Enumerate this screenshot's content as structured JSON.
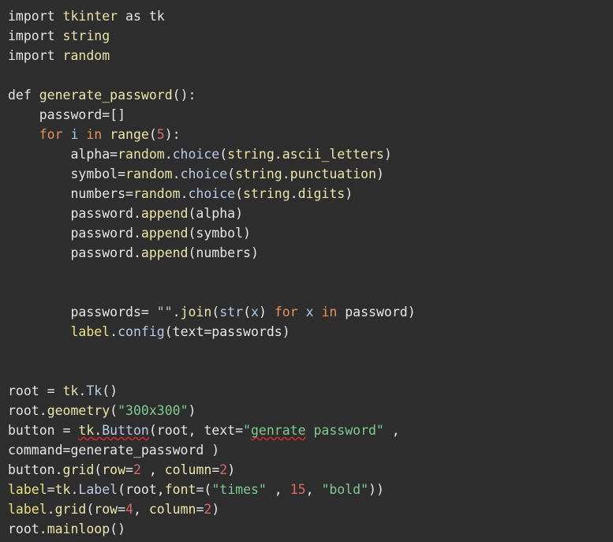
{
  "editor": {
    "background_color": "#2e2e2e",
    "default_text_color": "#e6e6e6",
    "language": "python",
    "palette": {
      "keyword": "#e8915a",
      "function": "#ece7a8",
      "method": "#b8cbe8",
      "identifier": "#a8c8e8",
      "number": "#d96a6a",
      "string": "#7fcc8f",
      "module": "#e9e3a4",
      "label_variable": "#e9e27e",
      "spellcheck_underline": "#cc2b2b"
    }
  },
  "code": {
    "lines": [
      {
        "id": "l1",
        "text": "import tkinter as tk"
      },
      {
        "id": "l2",
        "text": "import string"
      },
      {
        "id": "l3",
        "text": "import random"
      },
      {
        "id": "l4",
        "text": ""
      },
      {
        "id": "l5",
        "text": "def generate_password():"
      },
      {
        "id": "l6",
        "text": "    password=[]"
      },
      {
        "id": "l7",
        "text": "    for i in range(5):"
      },
      {
        "id": "l8",
        "text": "        alpha=random.choice(string.ascii_letters)"
      },
      {
        "id": "l9",
        "text": "        symbol=random.choice(string.punctuation)"
      },
      {
        "id": "l10",
        "text": "        numbers=random.choice(string.digits)"
      },
      {
        "id": "l11",
        "text": "        password.append(alpha)"
      },
      {
        "id": "l12",
        "text": "        password.append(symbol)"
      },
      {
        "id": "l13",
        "text": "        password.append(numbers)"
      },
      {
        "id": "l14",
        "text": ""
      },
      {
        "id": "l15",
        "text": ""
      },
      {
        "id": "l16",
        "text": "        passwords= \"\".join(str(x) for x in password)"
      },
      {
        "id": "l17",
        "text": "        label.config(text=passwords)"
      },
      {
        "id": "l18",
        "text": ""
      },
      {
        "id": "l19",
        "text": ""
      },
      {
        "id": "l20",
        "text": "root = tk.Tk()"
      },
      {
        "id": "l21",
        "text": "root.geometry(\"300x300\")"
      },
      {
        "id": "l22",
        "text": "button = tk.Button(root, text=\"genrate password\" ,"
      },
      {
        "id": "l23",
        "text": "command=generate_password )"
      },
      {
        "id": "l24",
        "text": "button.grid(row=2 , column=2)"
      },
      {
        "id": "l25",
        "text": "label=tk.Label(root,font=(\"times\" , 15, \"bold\"))"
      },
      {
        "id": "l26",
        "text": "label.grid(row=4, column=2)"
      },
      {
        "id": "l27",
        "text": "root.mainloop()"
      }
    ],
    "tokens": {
      "l1": [
        {
          "t": "import",
          "c": "c-plain"
        },
        {
          "t": " ",
          "c": "c-plain"
        },
        {
          "t": "tkinter",
          "c": "c-mod"
        },
        {
          "t": " ",
          "c": "c-plain"
        },
        {
          "t": "as",
          "c": "c-plain"
        },
        {
          "t": " ",
          "c": "c-plain"
        },
        {
          "t": "tk",
          "c": "c-plain"
        }
      ],
      "l2": [
        {
          "t": "import",
          "c": "c-plain"
        },
        {
          "t": " ",
          "c": "c-plain"
        },
        {
          "t": "string",
          "c": "c-mod"
        }
      ],
      "l3": [
        {
          "t": "import",
          "c": "c-plain"
        },
        {
          "t": " ",
          "c": "c-plain"
        },
        {
          "t": "random",
          "c": "c-mod"
        }
      ],
      "l5": [
        {
          "t": "def",
          "c": "c-plain"
        },
        {
          "t": " ",
          "c": "c-plain"
        },
        {
          "t": "generate_password",
          "c": "c-fn"
        },
        {
          "t": "():",
          "c": "c-plain"
        }
      ],
      "l6": [
        {
          "t": "    password=[]",
          "c": "c-plain"
        }
      ],
      "l7": [
        {
          "t": "    ",
          "c": "c-plain"
        },
        {
          "t": "for",
          "c": "c-kw"
        },
        {
          "t": " ",
          "c": "c-plain"
        },
        {
          "t": "i",
          "c": "c-ident"
        },
        {
          "t": " ",
          "c": "c-plain"
        },
        {
          "t": "in",
          "c": "c-kw"
        },
        {
          "t": " ",
          "c": "c-plain"
        },
        {
          "t": "range",
          "c": "c-fn"
        },
        {
          "t": "(",
          "c": "c-plain"
        },
        {
          "t": "5",
          "c": "c-num"
        },
        {
          "t": "):",
          "c": "c-plain"
        }
      ],
      "l8": [
        {
          "t": "        alpha=",
          "c": "c-plain"
        },
        {
          "t": "random",
          "c": "c-mod"
        },
        {
          "t": ".",
          "c": "c-plain"
        },
        {
          "t": "choice",
          "c": "c-attr"
        },
        {
          "t": "(",
          "c": "c-plain"
        },
        {
          "t": "string",
          "c": "c-mod"
        },
        {
          "t": ".",
          "c": "c-plain"
        },
        {
          "t": "ascii_letters",
          "c": "c-fn"
        },
        {
          "t": ")",
          "c": "c-plain"
        }
      ],
      "l9": [
        {
          "t": "        symbol=",
          "c": "c-plain"
        },
        {
          "t": "random",
          "c": "c-mod"
        },
        {
          "t": ".",
          "c": "c-plain"
        },
        {
          "t": "choice",
          "c": "c-attr"
        },
        {
          "t": "(",
          "c": "c-plain"
        },
        {
          "t": "string",
          "c": "c-mod"
        },
        {
          "t": ".",
          "c": "c-plain"
        },
        {
          "t": "punctuation",
          "c": "c-fn"
        },
        {
          "t": ")",
          "c": "c-plain"
        }
      ],
      "l10": [
        {
          "t": "        numbers=",
          "c": "c-plain"
        },
        {
          "t": "random",
          "c": "c-mod"
        },
        {
          "t": ".",
          "c": "c-plain"
        },
        {
          "t": "choice",
          "c": "c-attr"
        },
        {
          "t": "(",
          "c": "c-plain"
        },
        {
          "t": "string",
          "c": "c-mod"
        },
        {
          "t": ".",
          "c": "c-plain"
        },
        {
          "t": "digits",
          "c": "c-fn"
        },
        {
          "t": ")",
          "c": "c-plain"
        }
      ],
      "l11": [
        {
          "t": "        password",
          "c": "c-plain"
        },
        {
          "t": ".",
          "c": "c-plain"
        },
        {
          "t": "append",
          "c": "c-fn"
        },
        {
          "t": "(alpha)",
          "c": "c-plain"
        }
      ],
      "l12": [
        {
          "t": "        password",
          "c": "c-plain"
        },
        {
          "t": ".",
          "c": "c-plain"
        },
        {
          "t": "append",
          "c": "c-fn"
        },
        {
          "t": "(symbol)",
          "c": "c-plain"
        }
      ],
      "l13": [
        {
          "t": "        password",
          "c": "c-plain"
        },
        {
          "t": ".",
          "c": "c-plain"
        },
        {
          "t": "append",
          "c": "c-fn"
        },
        {
          "t": "(numbers)",
          "c": "c-plain"
        }
      ],
      "l16": [
        {
          "t": "        passwords= ",
          "c": "c-plain"
        },
        {
          "t": "\"\"",
          "c": "c-emptystr"
        },
        {
          "t": ".",
          "c": "c-plain"
        },
        {
          "t": "join",
          "c": "c-fn"
        },
        {
          "t": "(",
          "c": "c-plain"
        },
        {
          "t": "str",
          "c": "c-attr"
        },
        {
          "t": "(",
          "c": "c-plain"
        },
        {
          "t": "x",
          "c": "c-ident"
        },
        {
          "t": ") ",
          "c": "c-plain"
        },
        {
          "t": "for",
          "c": "c-kw"
        },
        {
          "t": " ",
          "c": "c-plain"
        },
        {
          "t": "x",
          "c": "c-ident"
        },
        {
          "t": " ",
          "c": "c-plain"
        },
        {
          "t": "in",
          "c": "c-kw"
        },
        {
          "t": " password)",
          "c": "c-plain"
        }
      ],
      "l17": [
        {
          "t": "        ",
          "c": "c-plain"
        },
        {
          "t": "label",
          "c": "c-lbl"
        },
        {
          "t": ".",
          "c": "c-plain"
        },
        {
          "t": "config",
          "c": "c-attr"
        },
        {
          "t": "(text=passwords)",
          "c": "c-plain"
        }
      ],
      "l20": [
        {
          "t": "root = ",
          "c": "c-plain"
        },
        {
          "t": "tk",
          "c": "c-mod"
        },
        {
          "t": ".",
          "c": "c-plain"
        },
        {
          "t": "Tk",
          "c": "c-attr"
        },
        {
          "t": "()",
          "c": "c-plain"
        }
      ],
      "l21": [
        {
          "t": "root",
          "c": "c-plain"
        },
        {
          "t": ".",
          "c": "c-plain"
        },
        {
          "t": "geometry",
          "c": "c-fn"
        },
        {
          "t": "(",
          "c": "c-plain"
        },
        {
          "t": "\"300x300\"",
          "c": "c-str"
        },
        {
          "t": ")",
          "c": "c-plain"
        }
      ],
      "l22": [
        {
          "t": "button = ",
          "c": "c-plain"
        },
        {
          "t": "tk",
          "c": "c-mod squiggle"
        },
        {
          "t": ".",
          "c": "c-plain squiggle"
        },
        {
          "t": "Button",
          "c": "c-attr squiggle"
        },
        {
          "t": "(root, text=",
          "c": "c-plain"
        },
        {
          "t": "\"",
          "c": "c-str"
        },
        {
          "t": "genrate",
          "c": "c-str squiggle"
        },
        {
          "t": " password\"",
          "c": "c-str"
        },
        {
          "t": " ,",
          "c": "c-plain"
        }
      ],
      "l23": [
        {
          "t": "command=generate_password )",
          "c": "c-plain"
        }
      ],
      "l24": [
        {
          "t": "button",
          "c": "c-plain"
        },
        {
          "t": ".",
          "c": "c-plain"
        },
        {
          "t": "grid",
          "c": "c-fn"
        },
        {
          "t": "(",
          "c": "c-plain"
        },
        {
          "t": "row",
          "c": "c-fn"
        },
        {
          "t": "=",
          "c": "c-plain"
        },
        {
          "t": "2",
          "c": "c-num"
        },
        {
          "t": " , ",
          "c": "c-plain"
        },
        {
          "t": "column",
          "c": "c-fn"
        },
        {
          "t": "=",
          "c": "c-plain"
        },
        {
          "t": "2",
          "c": "c-num"
        },
        {
          "t": ")",
          "c": "c-plain"
        }
      ],
      "l25": [
        {
          "t": "label",
          "c": "c-lbl"
        },
        {
          "t": "=",
          "c": "c-plain"
        },
        {
          "t": "tk",
          "c": "c-mod"
        },
        {
          "t": ".",
          "c": "c-plain"
        },
        {
          "t": "Label",
          "c": "c-attr"
        },
        {
          "t": "(root,",
          "c": "c-plain"
        },
        {
          "t": "font",
          "c": "c-fn"
        },
        {
          "t": "=(",
          "c": "c-plain"
        },
        {
          "t": "\"times\"",
          "c": "c-str"
        },
        {
          "t": " , ",
          "c": "c-plain"
        },
        {
          "t": "15",
          "c": "c-num"
        },
        {
          "t": ", ",
          "c": "c-plain"
        },
        {
          "t": "\"bold\"",
          "c": "c-str"
        },
        {
          "t": "))",
          "c": "c-plain"
        }
      ],
      "l26": [
        {
          "t": "label",
          "c": "c-lbl"
        },
        {
          "t": ".",
          "c": "c-plain"
        },
        {
          "t": "grid",
          "c": "c-fn"
        },
        {
          "t": "(",
          "c": "c-plain"
        },
        {
          "t": "row",
          "c": "c-fn"
        },
        {
          "t": "=",
          "c": "c-plain"
        },
        {
          "t": "4",
          "c": "c-num"
        },
        {
          "t": ", ",
          "c": "c-plain"
        },
        {
          "t": "column",
          "c": "c-fn"
        },
        {
          "t": "=",
          "c": "c-plain"
        },
        {
          "t": "2",
          "c": "c-num"
        },
        {
          "t": ")",
          "c": "c-plain"
        }
      ],
      "l27": [
        {
          "t": "root",
          "c": "c-plain"
        },
        {
          "t": ".",
          "c": "c-plain"
        },
        {
          "t": "mainloop",
          "c": "c-fn"
        },
        {
          "t": "()",
          "c": "c-plain"
        }
      ]
    }
  }
}
